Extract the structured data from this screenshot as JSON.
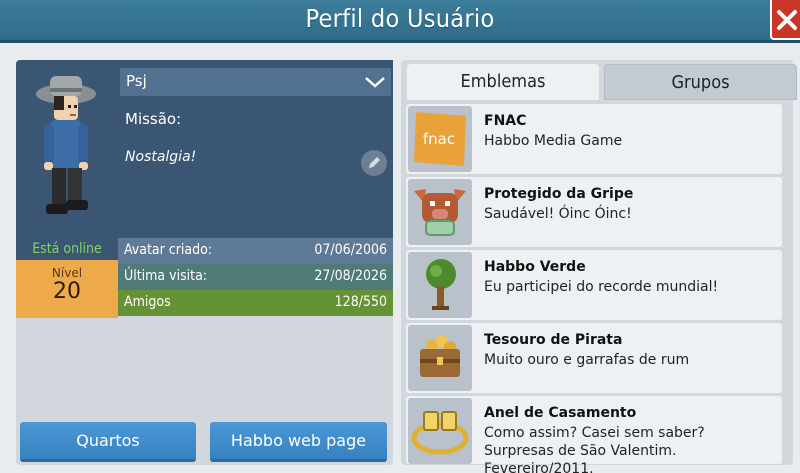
{
  "window": {
    "title": "Perfil do Usuário",
    "close_icon": "close-x-icon"
  },
  "profile": {
    "name": "Psj",
    "mission_label": "Missão:",
    "motto": "Nostalgia!",
    "online_status": "Está online",
    "level_label": "Nível",
    "level_value": "20",
    "stats": [
      {
        "label": "Avatar criado:",
        "value": "07/06/2006"
      },
      {
        "label": "Última visita:",
        "value": "27/08/2026"
      },
      {
        "label": "Amigos",
        "value": "128/550"
      }
    ],
    "buttons": {
      "rooms": "Quartos",
      "webpage": "Habbo web page"
    }
  },
  "tabs": [
    {
      "label": "Emblemas",
      "active": true
    },
    {
      "label": "Grupos",
      "active": false
    }
  ],
  "badges": [
    {
      "title": "FNAC",
      "desc": "Habbo Media Game",
      "icon": "fnac-badge-icon",
      "logo_text": "fnac"
    },
    {
      "title": "Protegido da Gripe",
      "desc": "Saudável! Óinc Óinc!",
      "icon": "pig-mask-badge-icon"
    },
    {
      "title": "Habbo Verde",
      "desc": "Eu participei do recorde mundial!",
      "icon": "tree-badge-icon"
    },
    {
      "title": "Tesouro de Pirata",
      "desc": "Muito ouro e garrafas de rum",
      "icon": "treasure-chest-badge-icon"
    },
    {
      "title": "Anel de Casamento",
      "desc": "Como assim? Casei sem saber? Surpresas de São Valentim. Fevereiro/2011.",
      "icon": "wedding-ring-badge-icon"
    }
  ],
  "colors": {
    "titlebar": "#2f6c89",
    "close": "#c73628",
    "online": "#7fd65e",
    "level_bg": "#eeaa4a",
    "button": "#3681c0"
  }
}
